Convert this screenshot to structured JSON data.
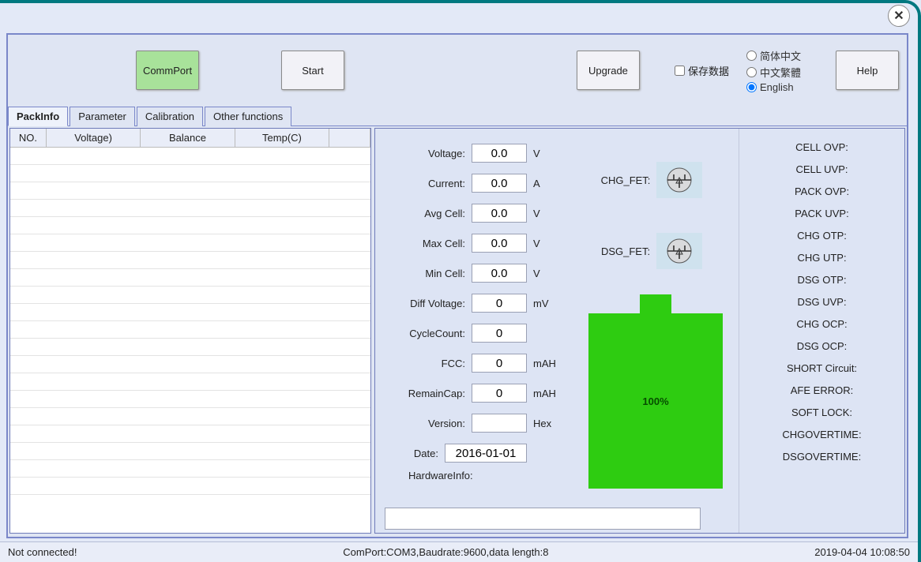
{
  "window": {
    "close_symbol": "✕"
  },
  "toolbar": {
    "comm_port": "CommPort",
    "start": "Start",
    "upgrade": "Upgrade",
    "save_data_label": "保存数据",
    "help": "Help"
  },
  "language": {
    "simplified": "简体中文",
    "traditional": "中文繁體",
    "english": "English",
    "selected": "english"
  },
  "tabs": {
    "packinfo": "PackInfo",
    "parameter": "Parameter",
    "calibration": "Calibration",
    "other": "Other functions",
    "active": "packinfo"
  },
  "grid": {
    "headers": {
      "no": "NO.",
      "voltage": "Voltage)",
      "balance": "Balance",
      "temp": "Temp(C)"
    }
  },
  "metrics": {
    "voltage": {
      "label": "Voltage:",
      "value": "0.0",
      "unit": "V"
    },
    "current": {
      "label": "Current:",
      "value": "0.0",
      "unit": "A"
    },
    "avg_cell": {
      "label": "Avg Cell:",
      "value": "0.0",
      "unit": "V"
    },
    "max_cell": {
      "label": "Max Cell:",
      "value": "0.0",
      "unit": "V"
    },
    "min_cell": {
      "label": "Min Cell:",
      "value": "0.0",
      "unit": "V"
    },
    "diff_voltage": {
      "label": "Diff Voltage:",
      "value": "0",
      "unit": "mV"
    },
    "cycle_count": {
      "label": "CycleCount:",
      "value": "0",
      "unit": ""
    },
    "fcc": {
      "label": "FCC:",
      "value": "0",
      "unit": "mAH"
    },
    "remain_cap": {
      "label": "RemainCap:",
      "value": "0",
      "unit": "mAH"
    },
    "version": {
      "label": "Version:",
      "value": "",
      "unit": "Hex"
    },
    "date": {
      "label": "Date:",
      "value": "2016-01-01",
      "unit": ""
    },
    "hwinfo_label": "HardwareInfo:",
    "hwinfo_value": ""
  },
  "fets": {
    "chg_label": "CHG_FET:",
    "dsg_label": "DSG_FET:"
  },
  "battery": {
    "percent_text": "100%"
  },
  "faults": {
    "cell_ovp": "CELL OVP:",
    "cell_uvp": "CELL UVP:",
    "pack_ovp": "PACK OVP:",
    "pack_uvp": "PACK UVP:",
    "chg_otp": "CHG OTP:",
    "chg_utp": "CHG UTP:",
    "dsg_otp": "DSG OTP:",
    "dsg_uvp": "DSG UVP:",
    "chg_ocp": "CHG OCP:",
    "dsg_ocp": "DSG OCP:",
    "short": "SHORT Circuit:",
    "afe": "AFE ERROR:",
    "soft_lock": "SOFT LOCK:",
    "chg_ot": "CHGOVERTIME:",
    "dsg_ot": "DSGOVERTIME:"
  },
  "status": {
    "connection": "Not connected!",
    "port": "ComPort:COM3,Baudrate:9600,data length:8",
    "datetime": "2019-04-04 10:08:50"
  }
}
